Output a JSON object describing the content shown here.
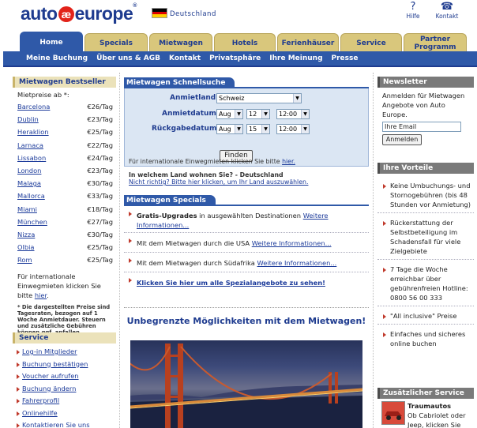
{
  "header": {
    "logo_part1": "auto",
    "logo_e": "æ",
    "logo_part2": "europe",
    "logo_tm": "®",
    "country": "Deutschland",
    "help_label": "Hilfe",
    "contact_label": "Kontakt",
    "help_icon": "question-icon",
    "contact_icon": "phone-icon"
  },
  "tabs": [
    {
      "label": "Home",
      "active": true
    },
    {
      "label": "Specials",
      "active": false
    },
    {
      "label": "Mietwagen",
      "active": false
    },
    {
      "label": "Hotels",
      "active": false
    },
    {
      "label": "Ferienhäuser",
      "active": false
    },
    {
      "label": "Service",
      "active": false
    },
    {
      "label": "Partner Programm",
      "active": false
    }
  ],
  "subnav": [
    "Meine Buchung",
    "Über uns & AGB",
    "Kontakt",
    "Privatsphäre",
    "Ihre Meinung",
    "Presse"
  ],
  "bestseller": {
    "title": "Mietwagen Bestseller",
    "subtitle": "Mietpreise ab *:",
    "rows": [
      {
        "city": "Barcelona",
        "price": "€26/Tag"
      },
      {
        "city": "Dublin",
        "price": "€23/Tag"
      },
      {
        "city": "Heraklion",
        "price": "€25/Tag"
      },
      {
        "city": "Larnaca",
        "price": "€22/Tag"
      },
      {
        "city": "Lissabon",
        "price": "€24/Tag"
      },
      {
        "city": "London",
        "price": "€23/Tag"
      },
      {
        "city": "Malaga",
        "price": "€30/Tag"
      },
      {
        "city": "Mallorca",
        "price": "€33/Tag"
      },
      {
        "city": "Miami",
        "price": "€18/Tag"
      },
      {
        "city": "München",
        "price": "€27/Tag"
      },
      {
        "city": "Nizza",
        "price": "€30/Tag"
      },
      {
        "city": "Olbia",
        "price": "€25/Tag"
      },
      {
        "city": "Rom",
        "price": "€25/Tag"
      }
    ],
    "intl_text": "Für internationale Einwegmieten klicken Sie bitte",
    "intl_link": "hier",
    "footnote": "* Die dargestellten Preise sind Tagesraten, bezogen auf 1 Woche Anmietdauer. Steuern und zusätzliche Gebühren können ggf. anfallen."
  },
  "service": {
    "title": "Service",
    "items": [
      "Log-in Mitglieder",
      "Buchung bestätigen",
      "Voucher aufrufen",
      "Buchung ändern",
      "Fahrerprofil",
      "Onlinehilfe",
      "Kontaktieren Sie uns"
    ]
  },
  "quicksearch": {
    "title": "Mietwagen Schnellsuche",
    "country_label": "Anmietland:",
    "country_value": "Schweiz",
    "pickup_label": "Anmietdatum:",
    "pickup_month": "Aug",
    "pickup_day": "12",
    "pickup_time": "12:00",
    "return_label": "Rückgabedatum:",
    "return_month": "Aug",
    "return_day": "15",
    "return_time": "12:00",
    "find_button": "Finden",
    "intl_text": "Für internationale Einwegmieten klicken Sie bitte",
    "intl_link": "hier.",
    "country_question": "In welchem Land wohnen Sie? - Deutschland",
    "country_change": "Nicht richtig? Bitte hier klicken, um Ihr Land auszuwählen."
  },
  "specials": {
    "title": "Mietwagen Specials",
    "items": [
      {
        "bold": "Gratis-Upgrades",
        "text": " in ausgewählten Destinationen ",
        "link": "Weitere Informationen..."
      },
      {
        "bold": "",
        "text": "Mit dem Mietwagen durch die USA ",
        "link": "Weitere Informationen..."
      },
      {
        "bold": "",
        "text": "Mit dem Mietwagen durch Südafrika ",
        "link": "Weitere Informationen..."
      }
    ],
    "all_link": "Klicken Sie hier um alle Spezialangebote zu sehen!"
  },
  "slogan": "Unbegrenzte Möglichkeiten mit dem Mietwagen!",
  "newsletter": {
    "title": "Newsletter",
    "text": "Anmelden für Mietwagen Angebote von Auto Europe.",
    "email_value": "Ihre Email",
    "button": "Anmelden"
  },
  "advantages": {
    "title": "Ihre Vorteile",
    "items": [
      "Keine Umbuchungs- und Stornogebühren (bis 48 Stunden vor Anmietung)",
      "Rückerstattung der Selbstbeteiligung im Schadensfall für viele Zielgebiete",
      "7 Tage die Woche erreichbar über gebührenfreien Hotline: 0800 56 00 333",
      "\"All inclusive\" Preise",
      "Einfaches und sicheres online buchen"
    ]
  },
  "extra_service": {
    "title": "Zusätzlicher Service",
    "item_title": "Traumautos",
    "item_text": "Ob Cabriolet oder Jeep, klicken Sie"
  },
  "colors": {
    "brand_blue": "#1e3b8f",
    "nav_blue": "#2f59a8",
    "tab_gold": "#d9c77c",
    "accent_red": "#e2231a"
  }
}
